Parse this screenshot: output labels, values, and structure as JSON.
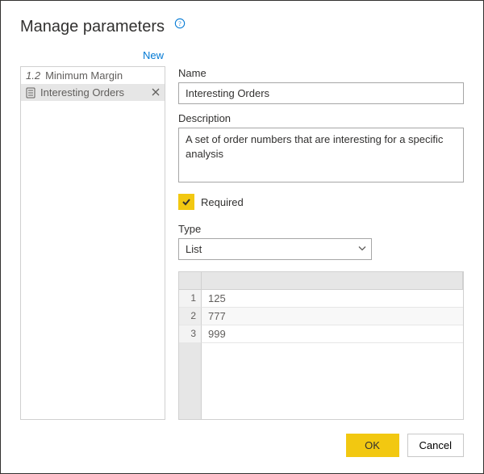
{
  "dialog": {
    "title": "Manage parameters",
    "help_tooltip": "Help",
    "new_link": "New"
  },
  "params": {
    "items": [
      {
        "prefix": "1.2",
        "label": "Minimum Margin",
        "selected": false
      },
      {
        "prefix": "",
        "label": "Interesting Orders",
        "selected": true
      }
    ]
  },
  "form": {
    "name_label": "Name",
    "name_value": "Interesting Orders",
    "desc_label": "Description",
    "desc_value": "A set of order numbers that are interesting for a specific analysis",
    "required_label": "Required",
    "required_checked": true,
    "type_label": "Type",
    "type_value": "List",
    "list_values": [
      "125",
      "777",
      "999"
    ]
  },
  "buttons": {
    "ok": "OK",
    "cancel": "Cancel"
  }
}
